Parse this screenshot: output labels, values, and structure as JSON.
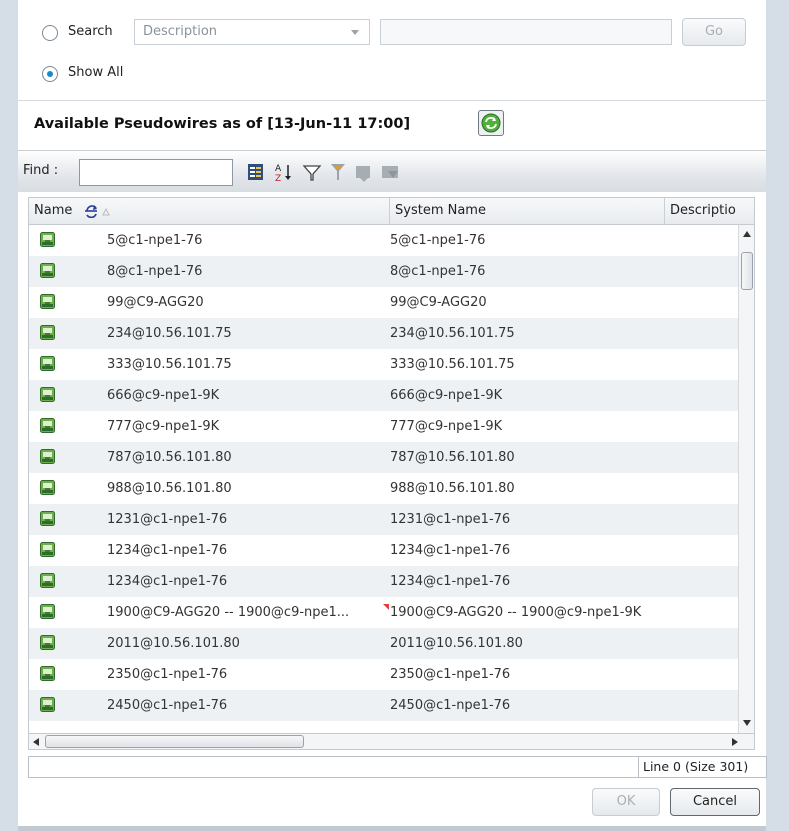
{
  "search_panel": {
    "search_radio_label": "Search",
    "search_field_selected": "Description",
    "search_value": "",
    "go_label": "Go",
    "show_all_label": "Show All",
    "selected_mode": "Show All"
  },
  "list_title": "Available Pseudowires as of [13-Jun-11 17:00]",
  "toolbar": {
    "find_label": "Find :",
    "find_value": ""
  },
  "table": {
    "columns": [
      "Name",
      "System Name",
      "Descriptio"
    ],
    "rows": [
      {
        "name": "5@c1-npe1-76",
        "system_name": "5@c1-npe1-76"
      },
      {
        "name": "8@c1-npe1-76",
        "system_name": "8@c1-npe1-76"
      },
      {
        "name": "99@C9-AGG20",
        "system_name": "99@C9-AGG20"
      },
      {
        "name": "234@10.56.101.75",
        "system_name": "234@10.56.101.75"
      },
      {
        "name": "333@10.56.101.75",
        "system_name": "333@10.56.101.75"
      },
      {
        "name": "666@c9-npe1-9K",
        "system_name": "666@c9-npe1-9K"
      },
      {
        "name": "777@c9-npe1-9K",
        "system_name": "777@c9-npe1-9K"
      },
      {
        "name": "787@10.56.101.80",
        "system_name": "787@10.56.101.80"
      },
      {
        "name": "988@10.56.101.80",
        "system_name": "988@10.56.101.80"
      },
      {
        "name": "1231@c1-npe1-76",
        "system_name": "1231@c1-npe1-76"
      },
      {
        "name": "1234@c1-npe1-76",
        "system_name": "1234@c1-npe1-76"
      },
      {
        "name": "1234@c1-npe1-76",
        "system_name": "1234@c1-npe1-76"
      },
      {
        "name": "1900@C9-AGG20 -- 1900@c9-npe1...",
        "system_name": "1900@C9-AGG20 -- 1900@c9-npe1-9K"
      },
      {
        "name": "2011@10.56.101.80",
        "system_name": "2011@10.56.101.80"
      },
      {
        "name": "2350@c1-npe1-76",
        "system_name": "2350@c1-npe1-76"
      },
      {
        "name": "2450@c1-npe1-76",
        "system_name": "2450@c1-npe1-76"
      }
    ]
  },
  "status_text": "Line 0 (Size 301)",
  "buttons": {
    "ok": "OK",
    "cancel": "Cancel"
  },
  "icons": {
    "row_icon": "pseudowire-icon",
    "refresh": "refresh-icon"
  },
  "colors": {
    "accent": "#1c88c7",
    "row_icon_green": "#3f8f3a",
    "alt_row": "#eef1f4"
  }
}
